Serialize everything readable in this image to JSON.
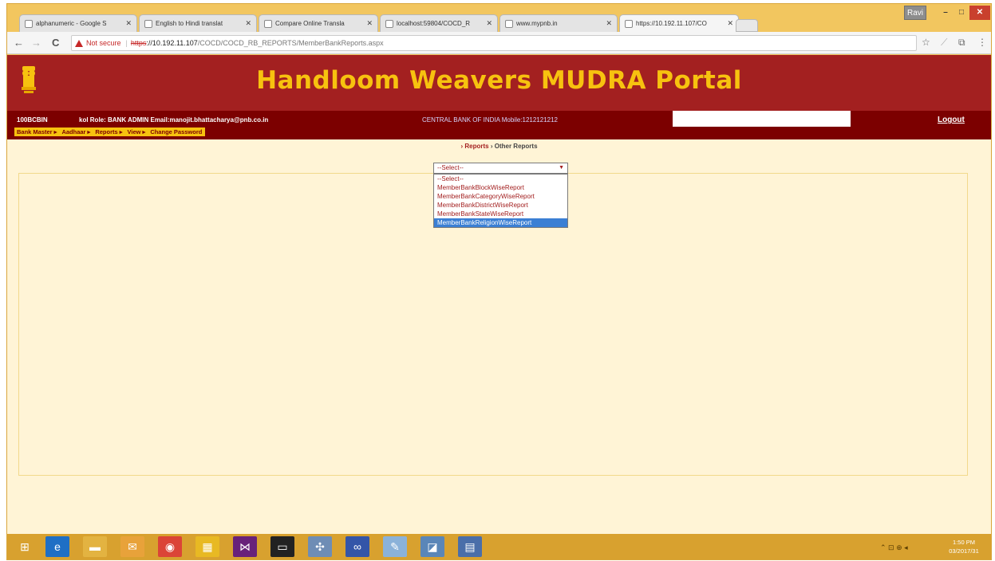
{
  "browser": {
    "window_controls": {
      "user": "Ravi",
      "minimize": "–",
      "maximize": "□",
      "close": "✕"
    },
    "tabs": [
      {
        "title": "alphanumeric - Google S",
        "active": false
      },
      {
        "title": "English to Hindi translat",
        "active": false
      },
      {
        "title": "Compare Online Transla",
        "active": false
      },
      {
        "title": "localhost:59804/COCD_R",
        "active": false
      },
      {
        "title": "www.mypnb.in",
        "active": false
      },
      {
        "title": "https://10.192.11.107/CO",
        "active": true
      }
    ],
    "tab_close": "✕",
    "nav": {
      "back": "←",
      "forward": "→",
      "reload": "C"
    },
    "address": {
      "security": "Not secure",
      "separator": "|",
      "protocol": "https",
      "host": "://10.192.11.107",
      "path": "/COCD/COCD_RB_REPORTS/MemberBankReports.aspx"
    },
    "toolbar_right": {
      "star": "☆",
      "ext1": "⟋",
      "ext2": "⧉",
      "menu": "⋮"
    }
  },
  "portal": {
    "title": "Handloom Weavers MUDRA Portal",
    "user_id": "100BCBIN",
    "user_info": "kol   Role: BANK ADMIN Email:manojit.bhattacharya@pnb.co.in",
    "bank_info": "CENTRAL BANK OF INDIA Mobile:1212121212",
    "logout": "Logout",
    "menu": [
      "Bank Master ▸",
      "Aadhaar ▸",
      "Reports ▸",
      "View ▸",
      "Change Password"
    ],
    "breadcrumb": {
      "first": "› Reports",
      "second": "› Other Reports"
    }
  },
  "report_select": {
    "selected": "--Select--",
    "arrow": "▼",
    "options": [
      "--Select--",
      "MemberBankBlockWiseReport",
      "MemberBankCategoryWiseReport",
      "MemberBankDistrictWiseReport",
      "MemberBankStateWiseReport",
      "MemberBankReligionWiseReport"
    ],
    "highlighted_index": 5
  },
  "taskbar": {
    "start": "⊞",
    "apps": [
      {
        "name": "internet-explorer-icon",
        "glyph": "e",
        "color": "#1f6fc5"
      },
      {
        "name": "file-explorer-icon",
        "glyph": "▬",
        "color": "#e3b341"
      },
      {
        "name": "outlook-icon",
        "glyph": "✉",
        "color": "#e8a23a"
      },
      {
        "name": "chrome-icon",
        "glyph": "◉",
        "color": "#db4437"
      },
      {
        "name": "app-grid-icon",
        "glyph": "▦",
        "color": "#e8b923"
      },
      {
        "name": "visual-studio-icon",
        "glyph": "⋈",
        "color": "#68217a"
      },
      {
        "name": "terminal-icon",
        "glyph": "▭",
        "color": "#222222"
      },
      {
        "name": "network-tool-icon",
        "glyph": "✣",
        "color": "#6e8db5"
      },
      {
        "name": "connector-icon",
        "glyph": "∞",
        "color": "#3455a8"
      },
      {
        "name": "paint-icon",
        "glyph": "✎",
        "color": "#8bb2d9"
      },
      {
        "name": "notes-icon",
        "glyph": "◪",
        "color": "#5a86b8"
      },
      {
        "name": "notepad-icon",
        "glyph": "▤",
        "color": "#4a6ea9"
      }
    ],
    "tray": "⌃  ⊡  ⊕  ◂",
    "time": "1:50 PM",
    "date": "03/2017/31"
  }
}
